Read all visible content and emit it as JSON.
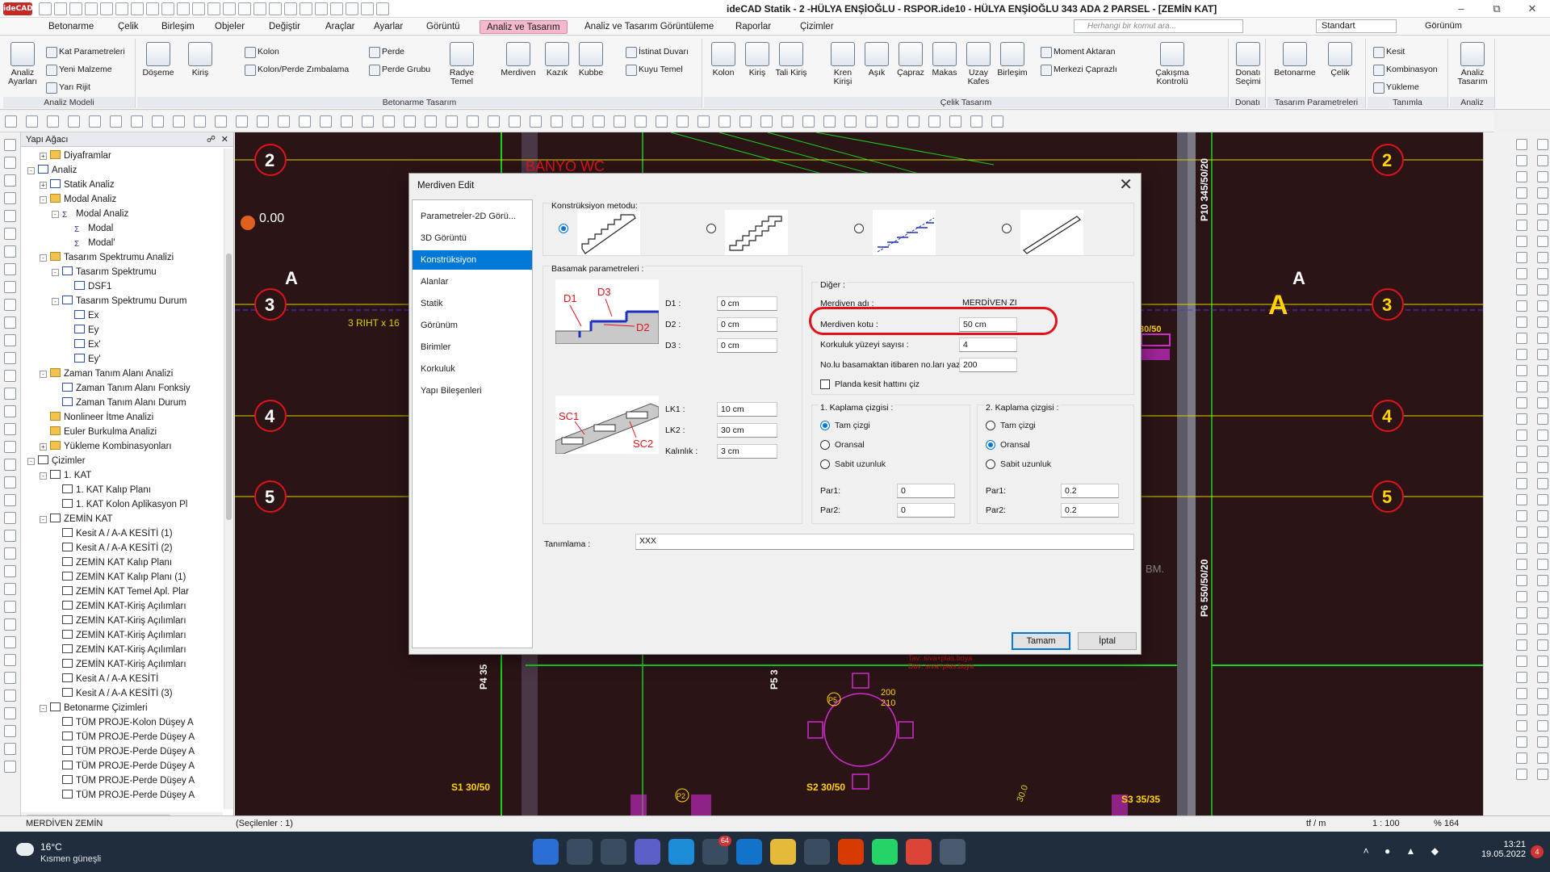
{
  "window": {
    "title": "ideCAD Statik - 2 -HÜLYA ENŞİOĞLU - RSPOR.ide10 - HÜLYA ENŞİOĞLU   343 ADA 2 PARSEL - [ZEMİN KAT]",
    "logo": "ideCAD"
  },
  "menu": {
    "tabs": [
      "Betonarme",
      "Çelik",
      "Birleşim",
      "Objeler",
      "Değiştir",
      "Araçlar",
      "Ayarlar",
      "Görüntü",
      "Analiz ve Tasarım",
      "Analiz ve Tasarım Görüntüleme",
      "Raporlar",
      "Çizimler"
    ],
    "active_tab": "Analiz ve Tasarım",
    "search_placeholder": "Herhangi bir komut ara...",
    "standard_select": "Standart",
    "view_label": "Görünüm"
  },
  "ribbon": {
    "groups": {
      "analiz_modeli": "Analiz Modeli",
      "betonarme_tasarim": "Betonarme Tasarım",
      "celik_tasarim": "Çelik Tasarım",
      "donati": "Donatı",
      "tasarim_parametreleri": "Tasarım Parametreleri",
      "tanimla": "Tanımla",
      "analiz": "Analiz"
    },
    "buttons": {
      "analiz_ayarlari": "Analiz Ayarları",
      "kat_parametreleri": "Kat Parametreleri",
      "yeni_malzeme": "Yeni Malzeme",
      "yari_rijit": "Yarı Rijit",
      "doseme": "Döşeme",
      "kiris": "Kiriş",
      "kolon": "Kolon",
      "kolon_perde_zimbalama": "Kolon/Perde Zımbalama",
      "perde": "Perde",
      "perde_grubu": "Perde Grubu",
      "radye_temel": "Radye Temel",
      "merdiven": "Merdiven",
      "kazik": "Kazık",
      "kubbe": "Kubbe",
      "istinat_duvari": "İstinat Duvarı",
      "kuyu_temel": "Kuyu Temel",
      "celik_kolon": "Kolon",
      "celik_kiris": "Kiriş",
      "tali_kiris": "Tali Kiriş",
      "kren_kirisi": "Kren Kirişi",
      "asik": "Aşık",
      "capraz": "Çapraz",
      "makas": "Makas",
      "uzay_kafes": "Uzay Kafes",
      "birlesim": "Birleşim",
      "moment_aktaran": "Moment Aktaran",
      "merkezi_caprazli": "Merkezi Çaprazlı",
      "cakisma_kontrolu": "Çakışma Kontrolü",
      "donati_secimi": "Donatı Seçimi",
      "betonarme": "Betonarme",
      "celik": "Çelik",
      "kesit": "Kesit",
      "kombinasyon": "Kombinasyon",
      "yukleme": "Yükleme",
      "analiz_tasarim": "Analiz Tasarım"
    }
  },
  "tree": {
    "title": "Yapı Ağacı",
    "items": [
      {
        "label": "Diyaframlar",
        "level": 2,
        "exp": "+",
        "icon": "folder"
      },
      {
        "label": "Analiz",
        "level": 1,
        "exp": "-",
        "icon": "graph"
      },
      {
        "label": "Statik Analiz",
        "level": 2,
        "exp": "+",
        "icon": "graph"
      },
      {
        "label": "Modal Analiz",
        "level": 2,
        "exp": "-",
        "icon": "folder"
      },
      {
        "label": "Modal Analiz",
        "level": 3,
        "exp": "-",
        "icon": "sigma"
      },
      {
        "label": "Modal",
        "level": 4,
        "exp": "",
        "icon": "sigma"
      },
      {
        "label": "Modal'",
        "level": 4,
        "exp": "",
        "icon": "sigma"
      },
      {
        "label": "Tasarım Spektrumu Analizi",
        "level": 2,
        "exp": "-",
        "icon": "folder"
      },
      {
        "label": "Tasarım Spektrumu",
        "level": 3,
        "exp": "-",
        "icon": "graph"
      },
      {
        "label": "DSF1",
        "level": 4,
        "exp": "",
        "icon": "graph"
      },
      {
        "label": "Tasarım Spektrumu Durum",
        "level": 3,
        "exp": "-",
        "icon": "graph"
      },
      {
        "label": "Ex",
        "level": 4,
        "exp": "",
        "icon": "graph"
      },
      {
        "label": "Ey",
        "level": 4,
        "exp": "",
        "icon": "graph"
      },
      {
        "label": "Ex'",
        "level": 4,
        "exp": "",
        "icon": "graph"
      },
      {
        "label": "Ey'",
        "level": 4,
        "exp": "",
        "icon": "graph"
      },
      {
        "label": "Zaman Tanım Alanı Analizi",
        "level": 2,
        "exp": "-",
        "icon": "folder"
      },
      {
        "label": "Zaman Tanım Alanı Fonksiy",
        "level": 3,
        "exp": "",
        "icon": "graph"
      },
      {
        "label": "Zaman Tanım Alanı Durum",
        "level": 3,
        "exp": "",
        "icon": "graph"
      },
      {
        "label": "Nonlineer İtme Analizi",
        "level": 2,
        "exp": "",
        "icon": "folder"
      },
      {
        "label": "Euler Burkulma Analizi",
        "level": 2,
        "exp": "",
        "icon": "folder"
      },
      {
        "label": "Yükleme Kombinasyonları",
        "level": 2,
        "exp": "+",
        "icon": "folder"
      },
      {
        "label": "Çizimler",
        "level": 1,
        "exp": "-",
        "icon": "doc"
      },
      {
        "label": "1. KAT",
        "level": 2,
        "exp": "-",
        "icon": "doc"
      },
      {
        "label": "1. KAT Kalıp Planı",
        "level": 3,
        "exp": "",
        "icon": "doc"
      },
      {
        "label": "1. KAT Kolon Aplikasyon Pl",
        "level": 3,
        "exp": "",
        "icon": "doc"
      },
      {
        "label": "ZEMİN KAT",
        "level": 2,
        "exp": "-",
        "icon": "doc"
      },
      {
        "label": "Kesit A / A-A KESİTİ (1)",
        "level": 3,
        "exp": "",
        "icon": "doc"
      },
      {
        "label": "Kesit A / A-A KESİTİ (2)",
        "level": 3,
        "exp": "",
        "icon": "doc"
      },
      {
        "label": "ZEMİN KAT Kalıp Planı",
        "level": 3,
        "exp": "",
        "icon": "doc"
      },
      {
        "label": "ZEMİN KAT Kalıp Planı (1)",
        "level": 3,
        "exp": "",
        "icon": "doc"
      },
      {
        "label": "ZEMİN KAT Temel Apl. Plar",
        "level": 3,
        "exp": "",
        "icon": "doc"
      },
      {
        "label": "ZEMİN KAT-Kiriş Açılımları",
        "level": 3,
        "exp": "",
        "icon": "doc"
      },
      {
        "label": "ZEMİN KAT-Kiriş Açılımları",
        "level": 3,
        "exp": "",
        "icon": "doc"
      },
      {
        "label": "ZEMİN KAT-Kiriş Açılımları",
        "level": 3,
        "exp": "",
        "icon": "doc"
      },
      {
        "label": "ZEMİN KAT-Kiriş Açılımları",
        "level": 3,
        "exp": "",
        "icon": "doc"
      },
      {
        "label": "ZEMİN KAT-Kiriş Açılımları",
        "level": 3,
        "exp": "",
        "icon": "doc"
      },
      {
        "label": "Kesit A / A-A KESİTİ",
        "level": 3,
        "exp": "",
        "icon": "doc"
      },
      {
        "label": "Kesit A / A-A KESİTİ (3)",
        "level": 3,
        "exp": "",
        "icon": "doc"
      },
      {
        "label": "Betonarme Çizimleri",
        "level": 2,
        "exp": "-",
        "icon": "doc"
      },
      {
        "label": "TÜM PROJE-Kolon Düşey A",
        "level": 3,
        "exp": "",
        "icon": "doc"
      },
      {
        "label": "TÜM PROJE-Perde Düşey A",
        "level": 3,
        "exp": "",
        "icon": "doc"
      },
      {
        "label": "TÜM PROJE-Perde Düşey A",
        "level": 3,
        "exp": "",
        "icon": "doc"
      },
      {
        "label": "TÜM PROJE-Perde Düşey A",
        "level": 3,
        "exp": "",
        "icon": "doc"
      },
      {
        "label": "TÜM PROJE-Perde Düşey A",
        "level": 3,
        "exp": "",
        "icon": "doc"
      },
      {
        "label": "TÜM PROJE-Perde Düşey A",
        "level": 3,
        "exp": "",
        "icon": "doc"
      }
    ]
  },
  "canvas": {
    "grid_rows": [
      "2",
      "3",
      "4",
      "5"
    ],
    "section_letter": "A",
    "elevation": "0.00",
    "rhythm": "3 RIHT x 16",
    "room_label": "BANYO WC",
    "column_labels": {
      "p10": "P10 345/50/20",
      "p6": "P6 550/50/20",
      "p4": "P4 35",
      "p5": "P5 3",
      "s1": "S1 30/50",
      "s2": "S2 30/50",
      "s3": "S3 35/35",
      "b30": "30/50",
      "bm": "BM.",
      "m200": "200",
      "m210": "210",
      "p5tag": "P5",
      "p2tag": "P2",
      "slope": "30.0"
    },
    "notes": [
      "Tav: sıva+plas.boya",
      "Duv: sıva+plas.boya"
    ],
    "colors": {
      "background": "#2b1416",
      "grid": "#d9d300",
      "circle": "#e0131a",
      "green": "#19d419",
      "magenta": "#d12bd1"
    }
  },
  "statusbar": {
    "left": "MERDİVEN ZEMİN",
    "selected": "(Seçilenler : 1)",
    "units": "tf / m",
    "scale": "1 : 100",
    "zoom": "% 164"
  },
  "taskbar": {
    "temp": "16°C",
    "weather": "Kısmen güneşli",
    "time": "13:21",
    "date": "19.05.2022",
    "teams_badge": "64",
    "notifications": "4"
  },
  "dialog": {
    "title": "Merdiven Edit",
    "nav": [
      "Parametreler-2D Görü...",
      "3D Görüntü",
      "Konstrüksiyon",
      "Alanlar",
      "Statik",
      "Görünüm",
      "Birimler",
      "Korkuluk",
      "Yapı Bileşenleri"
    ],
    "active_nav": "Konstrüksiyon",
    "method": {
      "label": "Konstrüksiyon metodu:",
      "selected": 0
    },
    "basamak": {
      "label": "Basamak parametreleri :",
      "d1_label": "D1 :",
      "d1": "0 cm",
      "d2_label": "D2 :",
      "d2": "0 cm",
      "d3_label": "D3 :",
      "d3": "0 cm",
      "lk1_label": "LK1 :",
      "lk1": "10 cm",
      "lk2_label": "LK2 :",
      "lk2": "30 cm",
      "kalinlik_label": "Kalınlık :",
      "kalinlik": "3 cm",
      "pic1": {
        "d1": "D1",
        "d2": "D2",
        "d3": "D3"
      },
      "pic2": {
        "sc1": "SC1",
        "sc2": "SC2"
      }
    },
    "diger": {
      "label": "Diğer :",
      "adi_label": "Merdiven adı :",
      "adi": "MERDİVEN ZI",
      "kotu_label": "Merdiven kotu :",
      "kotu": "50 cm",
      "korkuluk_label": "Korkuluk yüzeyi sayısı :",
      "korkuluk": "4",
      "nolu_label": "No.lu basamaktan itibaren no.ları yazma :",
      "nolu": "200",
      "planda_label": "Planda kesit hattını çiz"
    },
    "kaplama1": {
      "label": "1. Kaplama çizgisi :",
      "options": [
        "Tam çizgi",
        "Oransal",
        "Sabit uzunluk"
      ],
      "selected": 0,
      "par1_label": "Par1:",
      "par1": "0",
      "par2_label": "Par2:",
      "par2": "0"
    },
    "kaplama2": {
      "label": "2. Kaplama çizgisi :",
      "options": [
        "Tam çizgi",
        "Oransal",
        "Sabit uzunluk"
      ],
      "selected": 1,
      "par1_label": "Par1:",
      "par1": "0.2",
      "par2_label": "Par2:",
      "par2": "0.2"
    },
    "tanimlama_label": "Tanımlama :",
    "tanimlama": "XXX",
    "ok": "Tamam",
    "cancel": "İptal",
    "highlight_color": "#e0131a"
  }
}
